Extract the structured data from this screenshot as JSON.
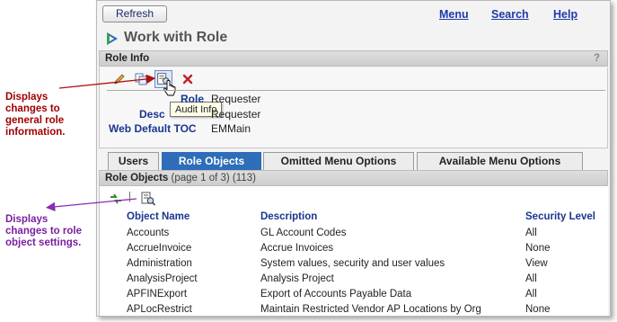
{
  "notes": {
    "general": "Displays changes to general role information.",
    "objects": "Displays changes to role object settings."
  },
  "topbar": {
    "refresh_label": "Refresh",
    "menu_label": "Menu",
    "search_label": "Search",
    "help_label": "Help"
  },
  "page_title": "Work with Role",
  "role_info": {
    "header": "Role Info",
    "help_mark": "?",
    "tooltip": "Audit Info",
    "fields": {
      "role_label": "Role",
      "role_value": "Requester",
      "desc_label": "Desc",
      "desc_value": "Requester",
      "toc_label": "Web Default TOC",
      "toc_value": "EMMain"
    }
  },
  "tabs": [
    "Users",
    "Role Objects",
    "Omitted Menu Options",
    "Available Menu Options"
  ],
  "active_tab": "Role Objects",
  "role_objects": {
    "header": "Role Objects",
    "page_info": "(page 1 of 3) (113)",
    "toolbar_sep": "|",
    "columns": [
      "Object Name",
      "Description",
      "Security Level"
    ],
    "rows": [
      {
        "name": "Accounts",
        "description": "GL Account Codes",
        "level": "All"
      },
      {
        "name": "AccrueInvoice",
        "description": "Accrue Invoices",
        "level": "None"
      },
      {
        "name": "Administration",
        "description": "System values, security and user values",
        "level": "View"
      },
      {
        "name": "AnalysisProject",
        "description": "Analysis Project",
        "level": "All"
      },
      {
        "name": "APFINExport",
        "description": "Export of Accounts Payable Data",
        "level": "All"
      },
      {
        "name": "APLocRestrict",
        "description": "Maintain Restricted Vendor AP Locations by Org",
        "level": "None"
      }
    ]
  },
  "colors": {
    "accent_blue": "#1f3aa8",
    "active_tab": "#2e6db8",
    "note_red": "#a00000",
    "note_purple": "#7a1fa0"
  },
  "icons": [
    "edit-icon",
    "copy-icon",
    "audit-info-icon",
    "delete-icon",
    "refresh-arrows-icon",
    "audit-icon",
    "hand-cursor-icon",
    "app-logo-icon"
  ]
}
